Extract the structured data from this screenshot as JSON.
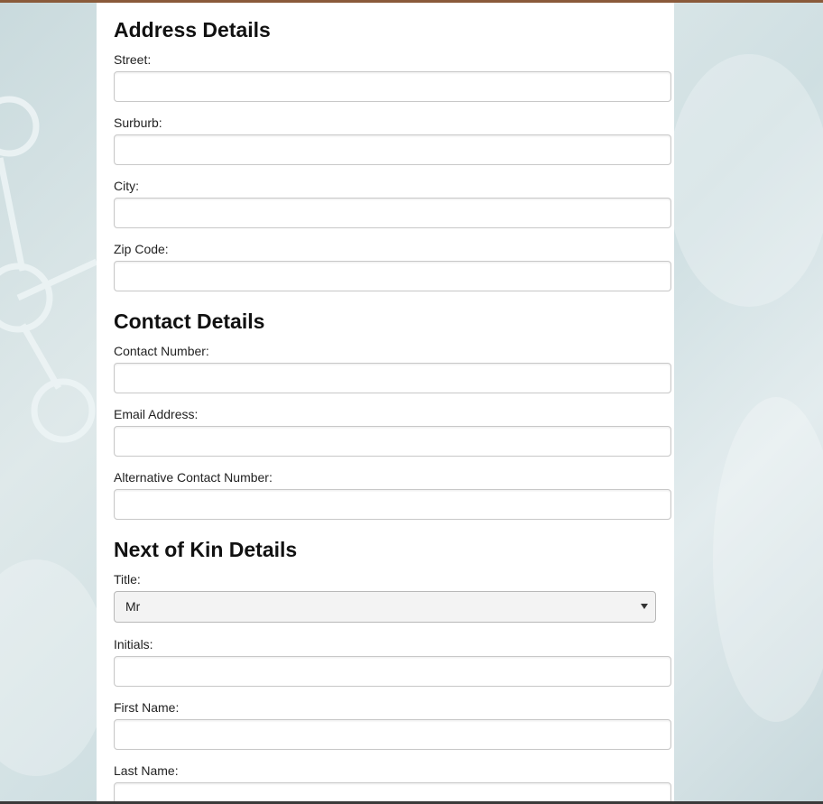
{
  "sections": {
    "address": {
      "title": "Address Details",
      "street_label": "Street:",
      "suburb_label": "Surburb:",
      "city_label": "City:",
      "zip_label": "Zip Code:"
    },
    "contact": {
      "title": "Contact Details",
      "number_label": "Contact Number:",
      "email_label": "Email Address:",
      "alt_label": "Alternative Contact Number:"
    },
    "kin": {
      "title": "Next of Kin Details",
      "title_label": "Title:",
      "title_value": "Mr",
      "initials_label": "Initials:",
      "first_label": "First Name:",
      "last_label": "Last Name:"
    }
  },
  "colors": {
    "panel": "#ffffff",
    "top_bar": "#8a5a3a",
    "background": "#d3e1e4"
  }
}
